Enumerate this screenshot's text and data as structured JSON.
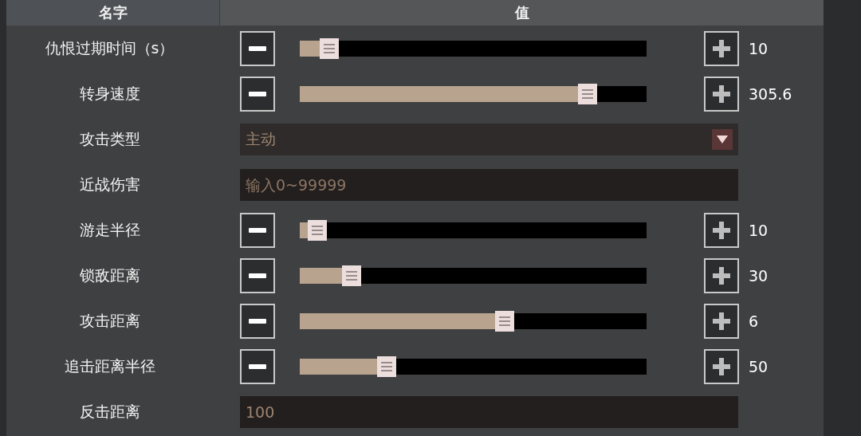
{
  "columns": [
    "名字",
    "值"
  ],
  "rows": [
    {
      "kind": "slider",
      "label": "仇恨过期时间（s）",
      "level": 0.085,
      "reading": "10"
    },
    {
      "kind": "slider",
      "label": "转身速度",
      "level": 0.83,
      "reading": "305.6"
    },
    {
      "kind": "dropdown",
      "label": "攻击类型",
      "value": "主动"
    },
    {
      "kind": "input",
      "label": "近战伤害",
      "placeholder": "输入0~99999"
    },
    {
      "kind": "slider",
      "label": "游走半径",
      "level": 0.05,
      "reading": "10"
    },
    {
      "kind": "slider",
      "label": "锁敌距离",
      "level": 0.15,
      "reading": "30"
    },
    {
      "kind": "slider",
      "label": "攻击距离",
      "level": 0.59,
      "reading": "6"
    },
    {
      "kind": "slider",
      "label": "追击距离半径",
      "level": 0.25,
      "reading": "50"
    },
    {
      "kind": "input",
      "label": "反击距离",
      "value": "100"
    }
  ]
}
